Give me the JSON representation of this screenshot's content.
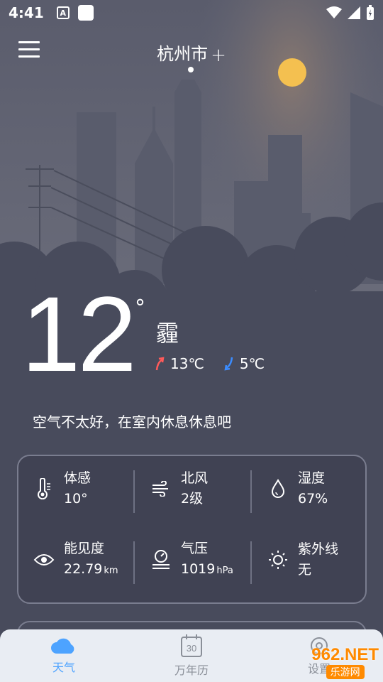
{
  "status_bar": {
    "time": "4:41",
    "a_icon": "A"
  },
  "header": {
    "city": "杭州市",
    "add": "+"
  },
  "weather": {
    "temperature": "12",
    "degree": "°",
    "condition": "霾",
    "high": "13℃",
    "low": "5℃",
    "tip": "空气不太好，在室内休息休息吧"
  },
  "stats": [
    {
      "label": "体感",
      "value": "10°",
      "unit": "",
      "icon": "thermometer-icon"
    },
    {
      "label": "北风",
      "value": "2级",
      "unit": "",
      "icon": "wind-icon"
    },
    {
      "label": "湿度",
      "value": "67%",
      "unit": "",
      "icon": "humidity-icon"
    },
    {
      "label": "能见度",
      "value": "22.79",
      "unit": "km",
      "icon": "eye-icon"
    },
    {
      "label": "气压",
      "value": "1019",
      "unit": "hPa",
      "icon": "pressure-icon"
    },
    {
      "label": "紫外线",
      "value": "无",
      "unit": "",
      "icon": "sun-icon"
    }
  ],
  "nav": [
    {
      "label": "天气",
      "icon": "cloud-icon",
      "active": true
    },
    {
      "label": "万年历",
      "icon": "calendar-icon",
      "calendar_day": "30",
      "active": false
    },
    {
      "label": "设置",
      "icon": "settings-icon",
      "active": false
    }
  ],
  "watermark": {
    "main": "962.NET",
    "sub": "乐游网"
  },
  "colors": {
    "sun": "#f4c050",
    "high_arrow": "#ff5a5a",
    "low_arrow": "#3b8cff",
    "accent": "#4da3ff"
  }
}
